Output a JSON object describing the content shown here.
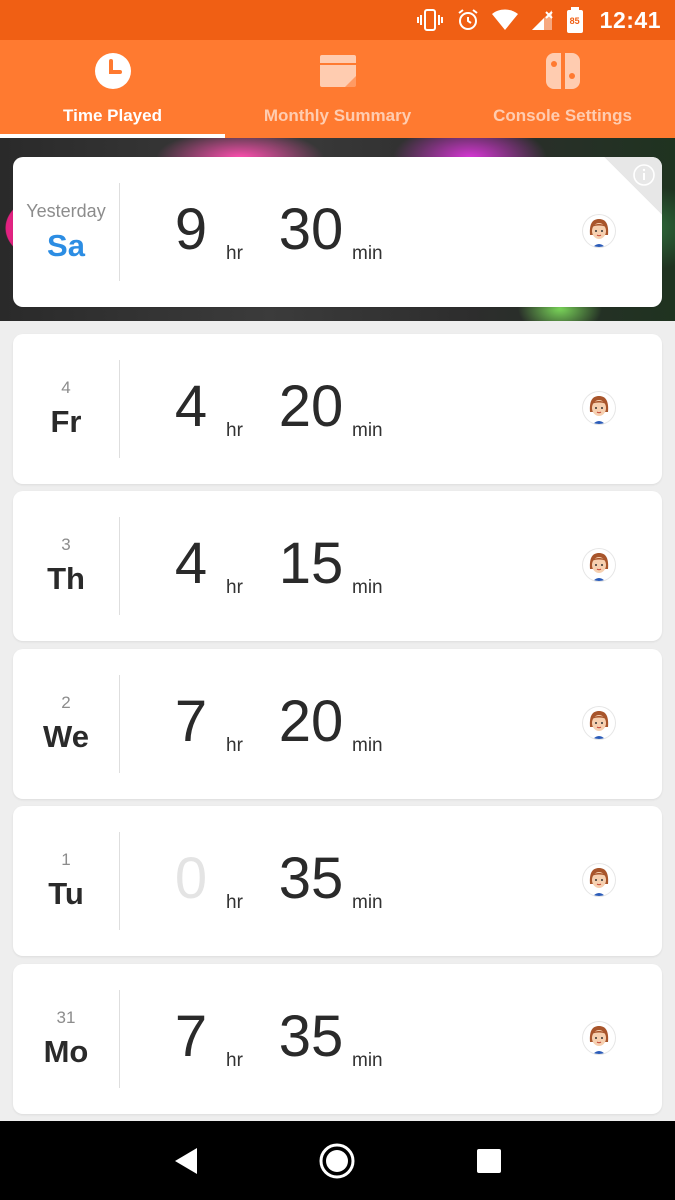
{
  "status_bar": {
    "time": "12:41",
    "battery_level": "85"
  },
  "tabs": [
    {
      "label": "Time Played",
      "icon": "clock-icon",
      "active": true
    },
    {
      "label": "Monthly Summary",
      "icon": "calendar-icon",
      "active": false
    },
    {
      "label": "Console Settings",
      "icon": "switch-console-icon",
      "active": false
    }
  ],
  "days": [
    {
      "day_num": "Yesterday",
      "day_name": "Sa",
      "hours": "9",
      "hr_unit": "hr",
      "minutes": "30",
      "min_unit": "min"
    },
    {
      "day_num": "4",
      "day_name": "Fr",
      "hours": "4",
      "hr_unit": "hr",
      "minutes": "20",
      "min_unit": "min"
    },
    {
      "day_num": "3",
      "day_name": "Th",
      "hours": "4",
      "hr_unit": "hr",
      "minutes": "15",
      "min_unit": "min"
    },
    {
      "day_num": "2",
      "day_name": "We",
      "hours": "7",
      "hr_unit": "hr",
      "minutes": "20",
      "min_unit": "min"
    },
    {
      "day_num": "1",
      "day_name": "Tu",
      "hours": "0",
      "hr_unit": "hr",
      "minutes": "35",
      "min_unit": "min"
    },
    {
      "day_num": "31",
      "day_name": "Mo",
      "hours": "7",
      "hr_unit": "hr",
      "minutes": "35",
      "min_unit": "min"
    }
  ],
  "colors": {
    "status_bar": "#f05f14",
    "tab_bar": "#ff7a30",
    "today_accent": "#2c8de3"
  }
}
